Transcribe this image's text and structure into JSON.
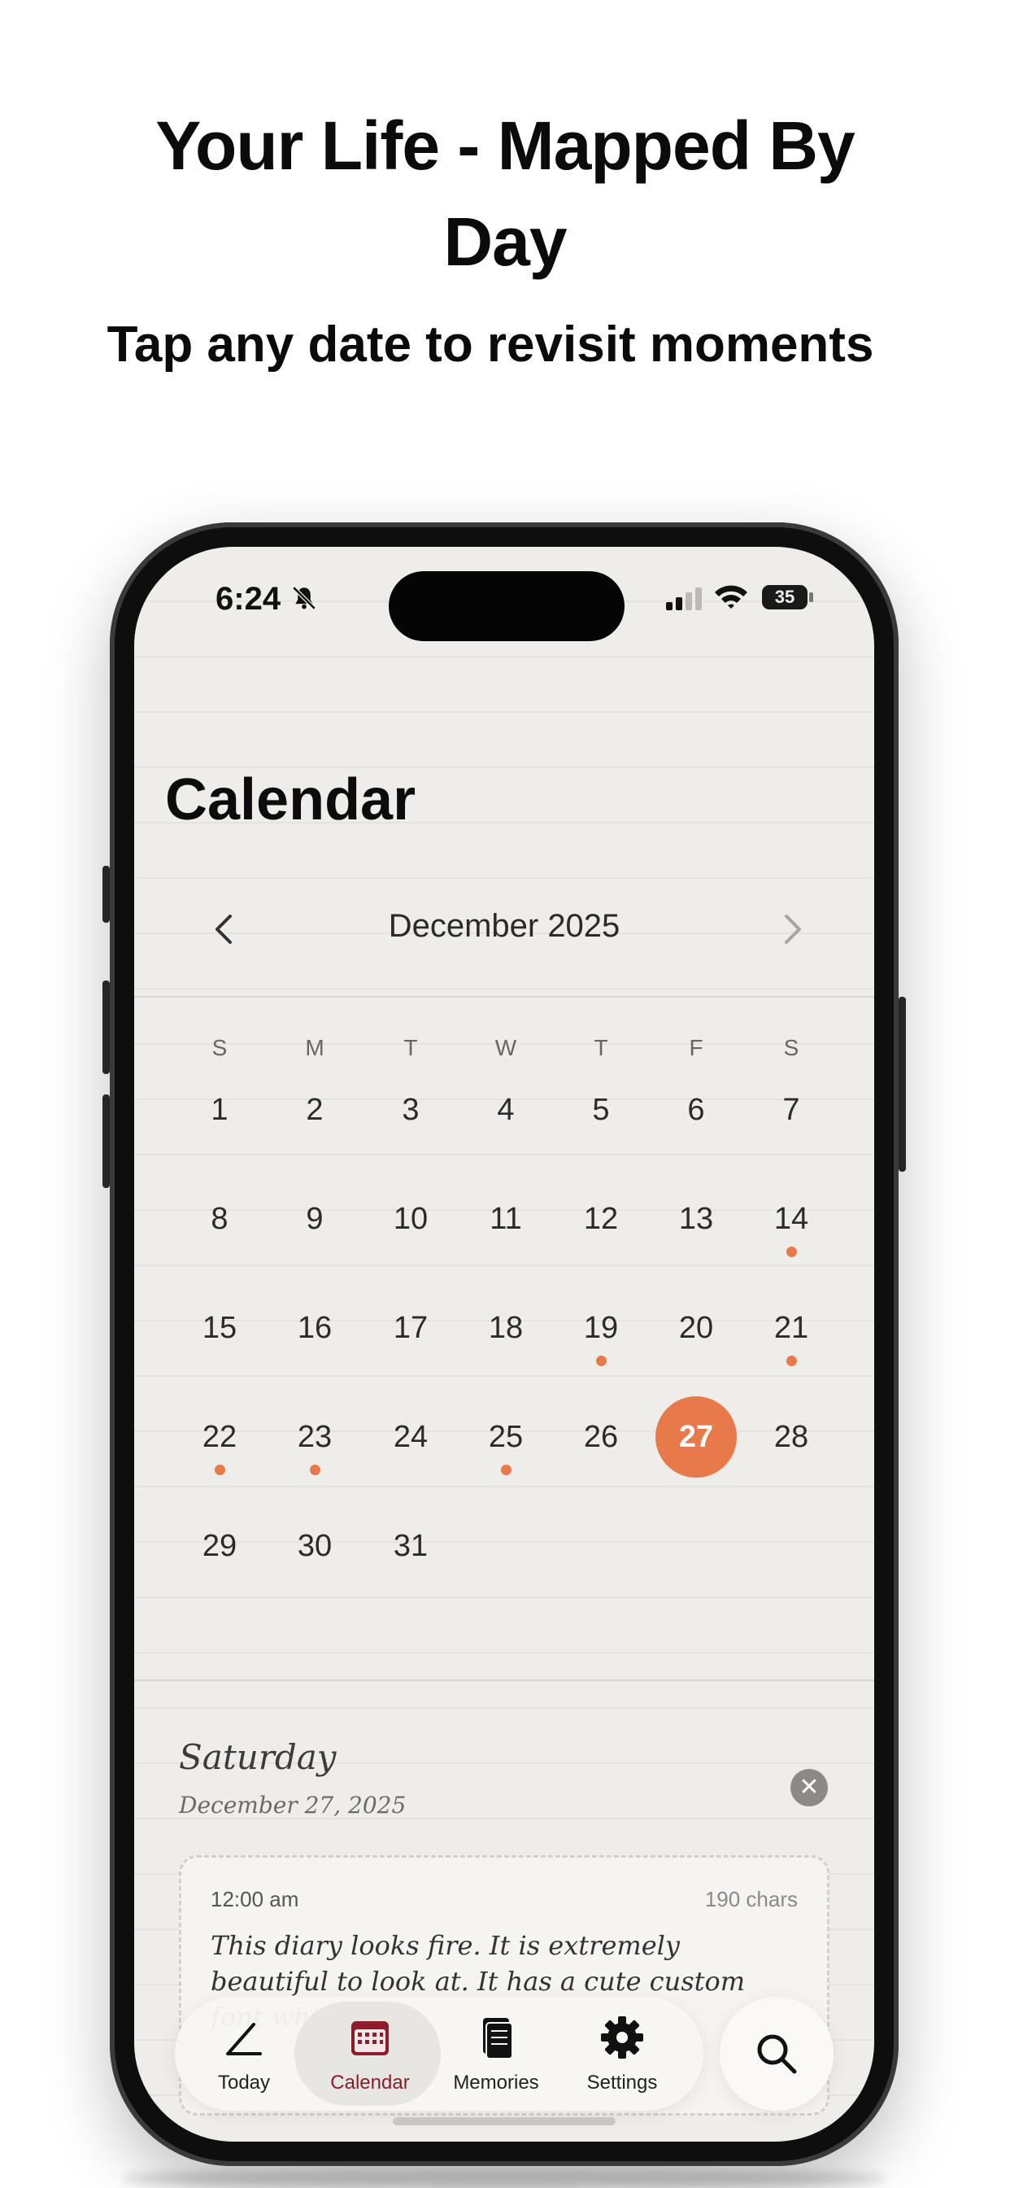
{
  "promo": {
    "headline_line1": "Your Life - Mapped By",
    "headline_line2": "Day",
    "subheadline": "Tap any date to revisit moments"
  },
  "status_bar": {
    "time": "6:24",
    "battery": "35"
  },
  "page_title": "Calendar",
  "calendar": {
    "month_label": "December 2025",
    "weekdays": [
      "S",
      "M",
      "T",
      "W",
      "T",
      "F",
      "S"
    ],
    "weeks": [
      [
        "1",
        "2",
        "3",
        "4",
        "5",
        "6",
        "7"
      ],
      [
        "8",
        "9",
        "10",
        "11",
        "12",
        "13",
        "14"
      ],
      [
        "15",
        "16",
        "17",
        "18",
        "19",
        "20",
        "21"
      ],
      [
        "22",
        "23",
        "24",
        "25",
        "26",
        "27",
        "28"
      ],
      [
        "29",
        "30",
        "31",
        "",
        "",
        "",
        ""
      ]
    ],
    "selected_day": "27",
    "days_with_entries": [
      "14",
      "19",
      "21",
      "22",
      "23",
      "25"
    ],
    "accent_color": "#e8794a"
  },
  "entry_panel": {
    "weekday": "Saturday",
    "date": "December 27, 2025",
    "entry": {
      "time": "12:00 am",
      "chars": "190 chars",
      "text": "This diary looks fire. It is extremely beautiful to look at. It has a cute custom font which I am"
    }
  },
  "tab_bar": {
    "tabs": [
      {
        "label": "Today",
        "icon": "pencil-icon"
      },
      {
        "label": "Calendar",
        "icon": "calendar-icon",
        "active": true
      },
      {
        "label": "Memories",
        "icon": "book-icon"
      },
      {
        "label": "Settings",
        "icon": "gear-icon"
      }
    ],
    "search_icon": "search-icon",
    "active_color": "#8c1d2b"
  }
}
